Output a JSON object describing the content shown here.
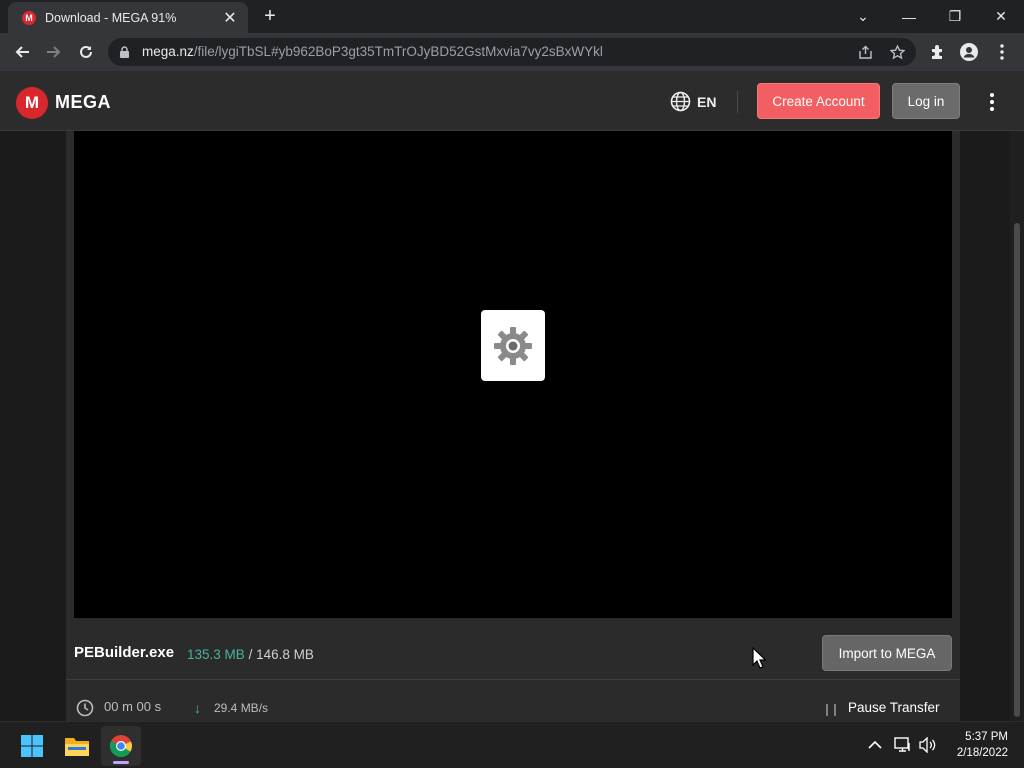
{
  "browser": {
    "tab": {
      "favicon_letter": "M",
      "title": "Download - MEGA 91%",
      "close_glyph": "✕"
    },
    "new_tab_glyph": "+",
    "window_controls": {
      "tab_search": "⌄",
      "minimize": "—",
      "restore": "❐",
      "close": "✕"
    },
    "url_host": "mega.nz",
    "url_path": "/file/lygiTbSL#yb962BoP3gt35TmTrOJyBD52GstMxvia7vy2sBxWYkl"
  },
  "mega": {
    "logo_letter": "M",
    "logo_text": "MEGA",
    "language": "EN",
    "create_account_label": "Create Account",
    "login_label": "Log in",
    "file": {
      "name": "PEBuilder.exe",
      "downloaded": "135.3 MB",
      "separator": "/",
      "total": "146.8 MB"
    },
    "import_label": "Import to MEGA",
    "time_left": "00 m  00 s",
    "speed": "29.4 MB/s",
    "pause_label": "Pause Transfer"
  },
  "taskbar": {
    "time": "5:37 PM",
    "date": "2/18/2022"
  },
  "colors": {
    "mega_red": "#d9272e",
    "create_button": "#f35e63",
    "progress_green": "#47b39c"
  }
}
